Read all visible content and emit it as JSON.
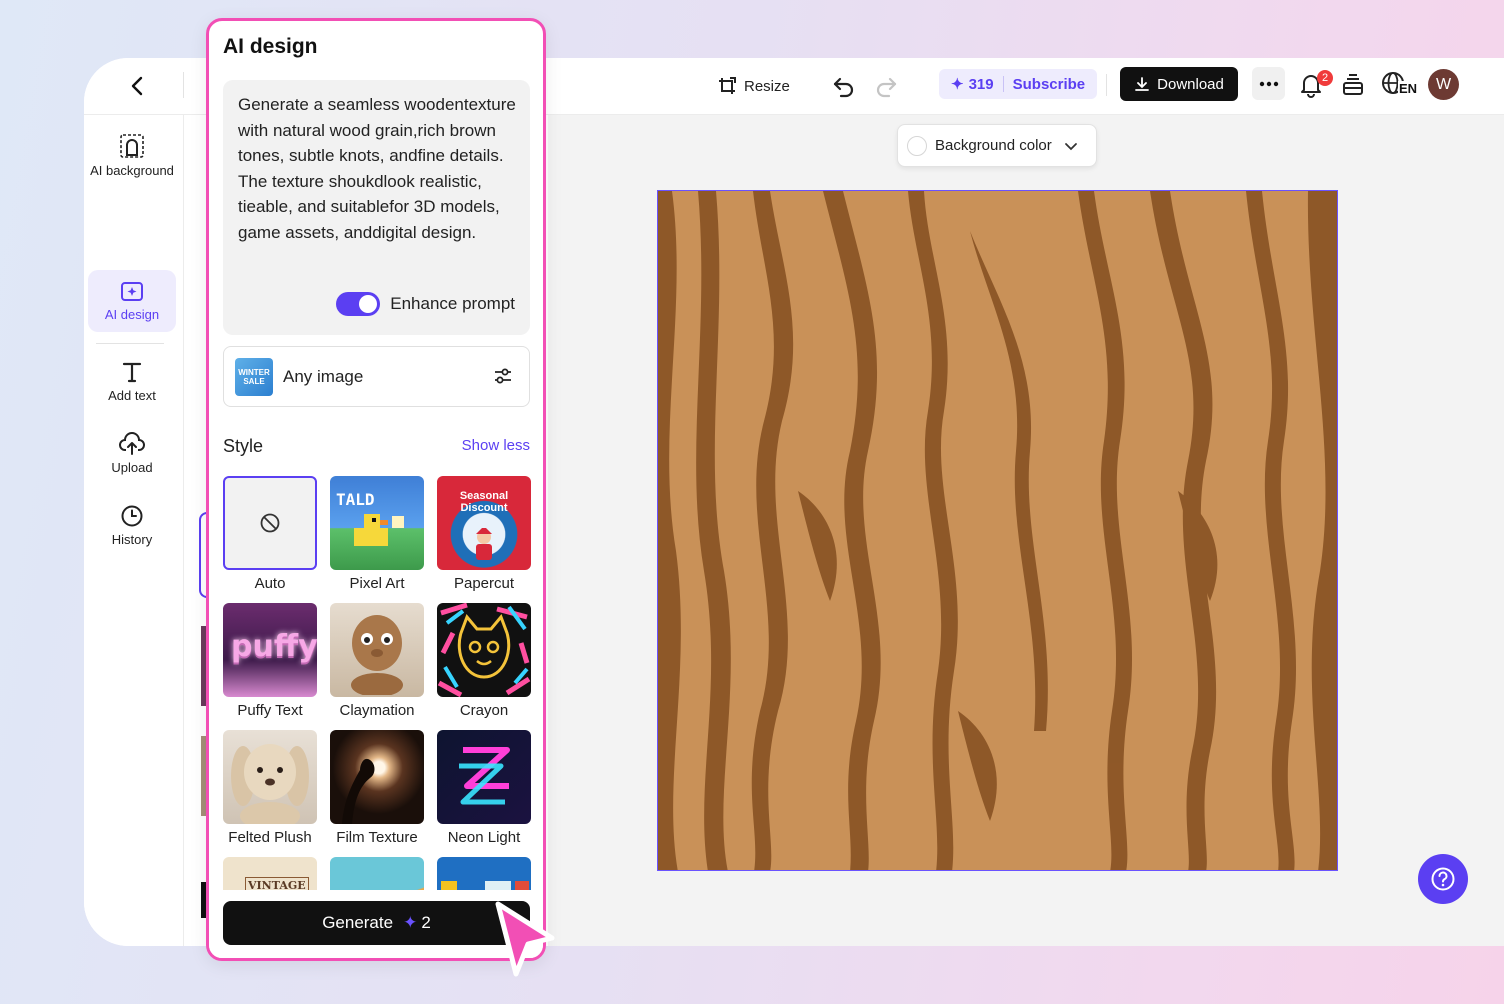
{
  "toolbar": {
    "resize_label": "Resize",
    "credits_count": "319",
    "subscribe_label": "Subscribe",
    "download_label": "Download",
    "notification_count": "2",
    "language_code": "EN",
    "avatar_initial": "W"
  },
  "sidebar": {
    "items": [
      {
        "label": "AI background",
        "icon": "ai-background-icon"
      },
      {
        "label": "AI design",
        "icon": "ai-design-icon",
        "active": true
      },
      {
        "label": "Add text",
        "icon": "text-icon"
      },
      {
        "label": "Upload",
        "icon": "upload-icon"
      },
      {
        "label": "History",
        "icon": "history-icon"
      }
    ]
  },
  "canvas": {
    "background_color_label": "Background color"
  },
  "panel": {
    "title": "AI design",
    "prompt_text": "Generate a seamless woodentexture with natural wood grain,rich brown tones, subtle knots, andfine details. The texture shoukdlook realistic, tieable, and suitablefor 3D models, game assets, anddigital design.",
    "enhance_prompt_label": "Enhance prompt",
    "enhance_prompt_on": true,
    "image_type_label": "Any image",
    "image_type_thumb_text": "WINTER SALE",
    "style_label": "Style",
    "show_less_label": "Show less",
    "styles": [
      {
        "label": "Auto",
        "selected": true,
        "thumb_text": ""
      },
      {
        "label": "Pixel Art",
        "thumb_text": "TALD"
      },
      {
        "label": "Papercut",
        "thumb_text": "Seasonal Discount"
      },
      {
        "label": "Puffy Text",
        "thumb_text": "puffy"
      },
      {
        "label": "Claymation",
        "thumb_text": ""
      },
      {
        "label": "Crayon",
        "thumb_text": ""
      },
      {
        "label": "Felted Plush",
        "thumb_text": ""
      },
      {
        "label": "Film Texture",
        "thumb_text": ""
      },
      {
        "label": "Neon Light",
        "thumb_text": ""
      },
      {
        "label": "",
        "thumb_text": "VINTAGE"
      },
      {
        "label": "",
        "thumb_text": ""
      },
      {
        "label": "",
        "thumb_text": ""
      }
    ],
    "generate_label": "Generate",
    "generate_cost": "2"
  },
  "colors": {
    "accent": "#5b3ff2",
    "panel_border": "#f24fb5",
    "wood_light": "#c99158",
    "wood_dark": "#8a5424"
  }
}
